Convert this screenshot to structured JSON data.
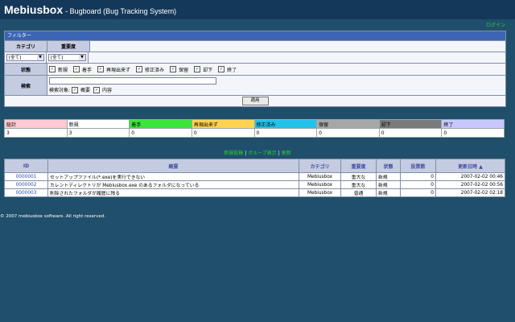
{
  "header": {
    "app_name": "Mebiusbox",
    "subtitle": "- Bugboard (Bug Tracking System)"
  },
  "login": "ログイン",
  "filter": {
    "title": "フィルター",
    "category_label": "カテゴリ",
    "severity_label": "重要度",
    "category_value": "[全て]",
    "severity_value": "[全て]",
    "status_label": "状態",
    "statuses": [
      "新規",
      "着手",
      "再現出来ず",
      "修正済み",
      "保留",
      "却下",
      "終了"
    ],
    "search_label": "検索",
    "search_value": "",
    "search_target_label": "検索対象:",
    "search_targets": [
      "概要",
      "内容"
    ],
    "apply_label": "適用"
  },
  "stats": {
    "headers": [
      "総計",
      "新規",
      "着手",
      "再現出来ず",
      "修正済み",
      "保留",
      "却下",
      "終了"
    ],
    "values": [
      "3",
      "3",
      "0",
      "0",
      "0",
      "0",
      "0",
      "0"
    ],
    "colors": [
      "#ffc9d1",
      "#ffffff",
      "#39e639",
      "#ffd34f",
      "#22c2ea",
      "#a7a7a7",
      "#7b7b7b",
      "#c8c8ff"
    ]
  },
  "links": {
    "new_post": "新規投稿",
    "group_view": "グループ表示",
    "refresh": "更新"
  },
  "table": {
    "headers": [
      "ID",
      "概要",
      "カテゴリ",
      "重要度",
      "状態",
      "投票数",
      "更新日時 ▲"
    ],
    "rows": [
      [
        "0000001",
        "セットアップファイル(*.exe)を実行できない",
        "Mebiusbox",
        "重大な",
        "新規",
        "0",
        "2007-02-02 00:46"
      ],
      [
        "0000002",
        "カレントディレクトリが Mebiusbox.exe のあるフォルダになっている",
        "Mebiusbox",
        "重大な",
        "新規",
        "0",
        "2007-02-02 00:56"
      ],
      [
        "0000003",
        "削除されたフォルダが履歴に残る",
        "Mebiusbox",
        "普通",
        "新規",
        "0",
        "2007-02-02 02:18"
      ]
    ]
  },
  "footer": "© 2007 mebiusbox software. All right reserved."
}
